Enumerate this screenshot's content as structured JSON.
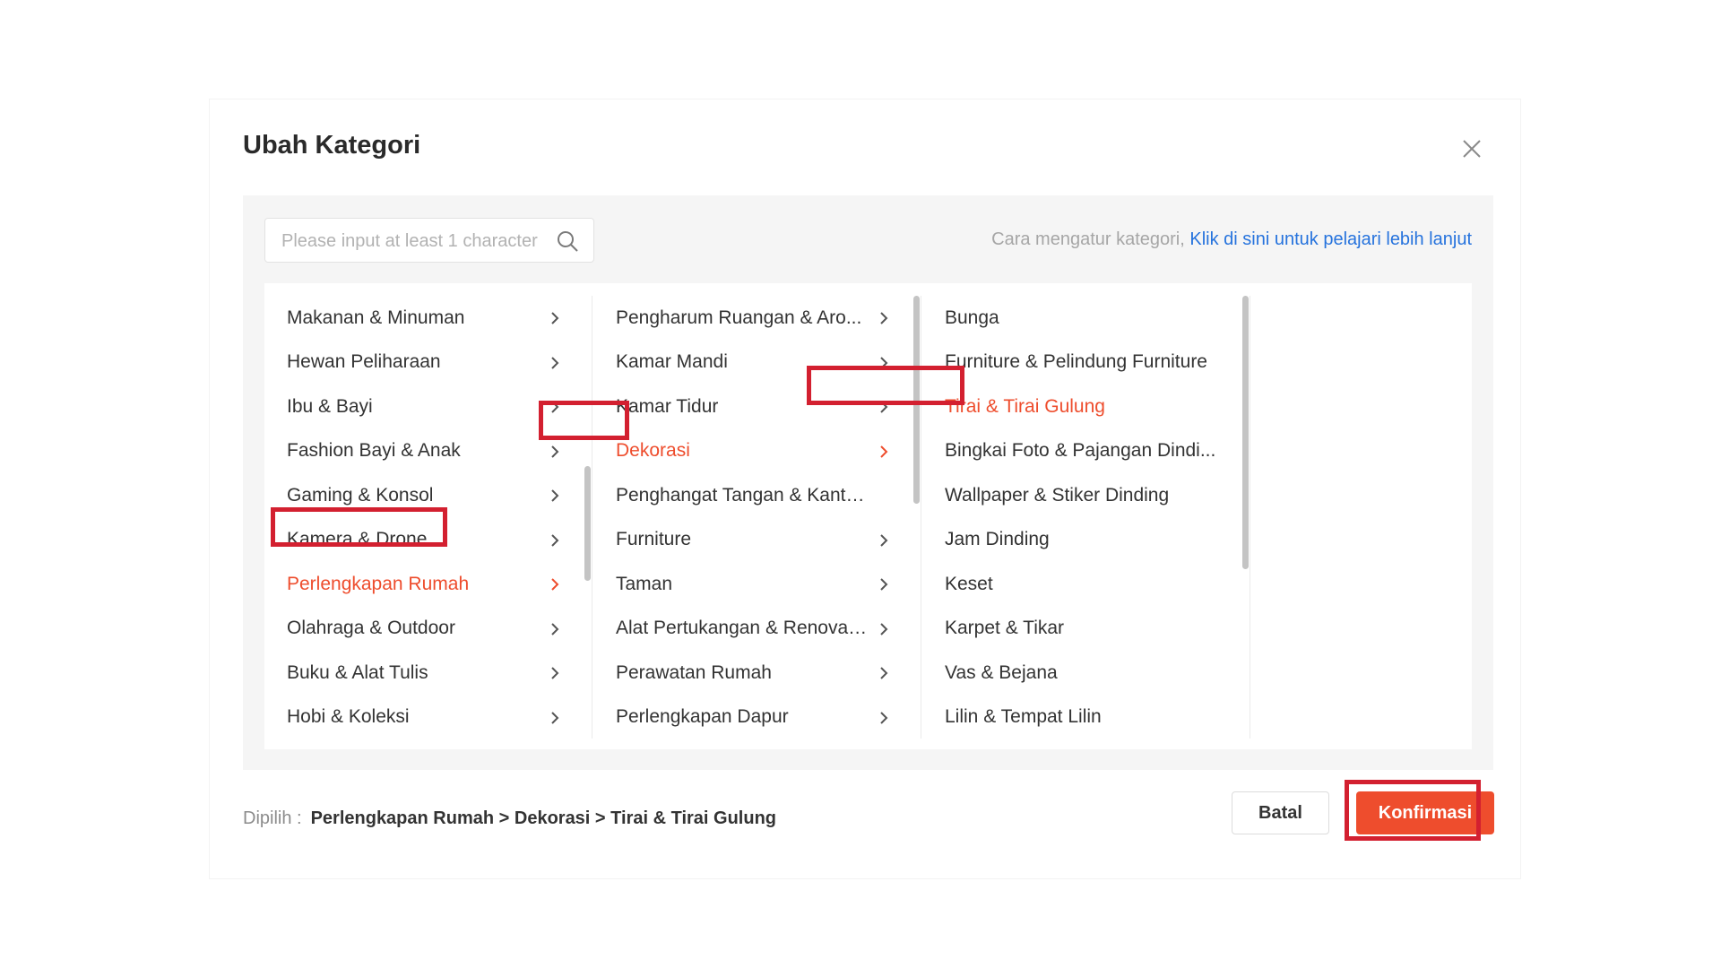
{
  "modal": {
    "title": "Ubah Kategori",
    "close_icon": "close-icon"
  },
  "search": {
    "placeholder": "Please input at least 1 character",
    "value": "",
    "icon": "search-icon"
  },
  "help": {
    "prefix": "Cara mengatur kategori,",
    "link": "Klik di sini untuk pelajari lebih lanjut"
  },
  "columns": [
    {
      "items": [
        {
          "label": "Makanan & Minuman",
          "has_children": true,
          "selected": false
        },
        {
          "label": "Hewan Peliharaan",
          "has_children": true,
          "selected": false
        },
        {
          "label": "Ibu & Bayi",
          "has_children": true,
          "selected": false
        },
        {
          "label": "Fashion Bayi & Anak",
          "has_children": true,
          "selected": false
        },
        {
          "label": "Gaming & Konsol",
          "has_children": true,
          "selected": false
        },
        {
          "label": "Kamera & Drone",
          "has_children": true,
          "selected": false
        },
        {
          "label": "Perlengkapan Rumah",
          "has_children": true,
          "selected": true
        },
        {
          "label": "Olahraga & Outdoor",
          "has_children": true,
          "selected": false
        },
        {
          "label": "Buku & Alat Tulis",
          "has_children": true,
          "selected": false
        },
        {
          "label": "Hobi & Koleksi",
          "has_children": true,
          "selected": false
        }
      ]
    },
    {
      "items": [
        {
          "label": "Pengharum Ruangan & Aro...",
          "has_children": true,
          "selected": false
        },
        {
          "label": "Kamar Mandi",
          "has_children": true,
          "selected": false
        },
        {
          "label": "Kamar Tidur",
          "has_children": true,
          "selected": false
        },
        {
          "label": "Dekorasi",
          "has_children": true,
          "selected": true
        },
        {
          "label": "Penghangat Tangan & Kantong...",
          "has_children": false,
          "selected": false
        },
        {
          "label": "Furniture",
          "has_children": true,
          "selected": false
        },
        {
          "label": "Taman",
          "has_children": true,
          "selected": false
        },
        {
          "label": "Alat Pertukangan & Renovas...",
          "has_children": true,
          "selected": false
        },
        {
          "label": "Perawatan Rumah",
          "has_children": true,
          "selected": false
        },
        {
          "label": "Perlengkapan Dapur",
          "has_children": true,
          "selected": false
        }
      ]
    },
    {
      "items": [
        {
          "label": "Bunga",
          "has_children": false,
          "selected": false
        },
        {
          "label": "Furniture & Pelindung Furniture",
          "has_children": false,
          "selected": false
        },
        {
          "label": "Tirai & Tirai Gulung",
          "has_children": false,
          "selected": true
        },
        {
          "label": "Bingkai Foto & Pajangan Dindi...",
          "has_children": false,
          "selected": false
        },
        {
          "label": "Wallpaper & Stiker Dinding",
          "has_children": false,
          "selected": false
        },
        {
          "label": "Jam Dinding",
          "has_children": false,
          "selected": false
        },
        {
          "label": "Keset",
          "has_children": false,
          "selected": false
        },
        {
          "label": "Karpet & Tikar",
          "has_children": false,
          "selected": false
        },
        {
          "label": "Vas & Bejana",
          "has_children": false,
          "selected": false
        },
        {
          "label": "Lilin & Tempat Lilin",
          "has_children": false,
          "selected": false
        }
      ]
    }
  ],
  "footer": {
    "selected_label": "Dipilih :",
    "selected_path": "Perlengkapan Rumah > Dekorasi > Tirai & Tirai Gulung",
    "cancel_label": "Batal",
    "confirm_label": "Konfirmasi"
  },
  "colors": {
    "accent": "#ee4d2d",
    "link": "#2673dd",
    "highlight_box": "#d32030"
  }
}
